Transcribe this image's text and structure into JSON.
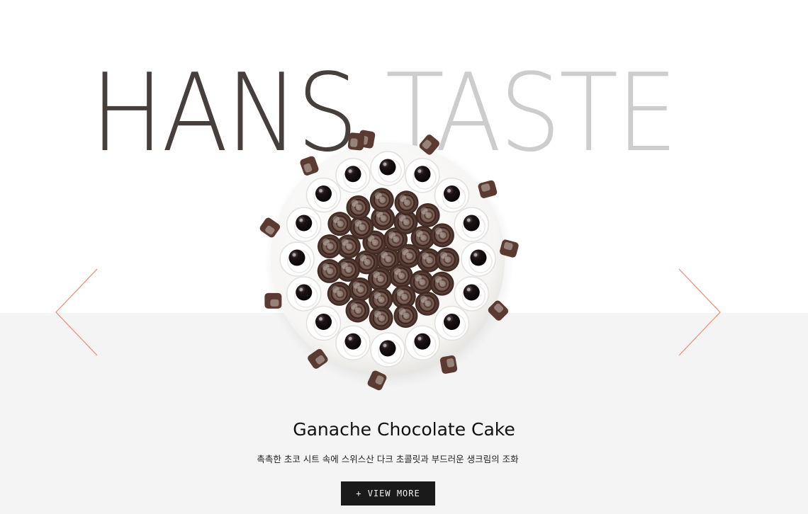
{
  "hero": {
    "title_word1": "HANS",
    "title_word2": "TASTE"
  },
  "slider": {
    "prev_icon": "chevron-left-icon",
    "next_icon": "chevron-right-icon",
    "arrow_color": "#f08a6c"
  },
  "product": {
    "name": "Ganache Chocolate Cake",
    "description": "촉촉한 초코 시트 속에 스위스산 다크 초콜릿과 부드러운 생크림의 조화",
    "button_label": "+ VIEW MORE"
  },
  "colors": {
    "title_dark": "#463f3c",
    "title_light": "#cdcdcd",
    "band_background": "#f4f4f4",
    "button_background": "#1a1a1a"
  }
}
